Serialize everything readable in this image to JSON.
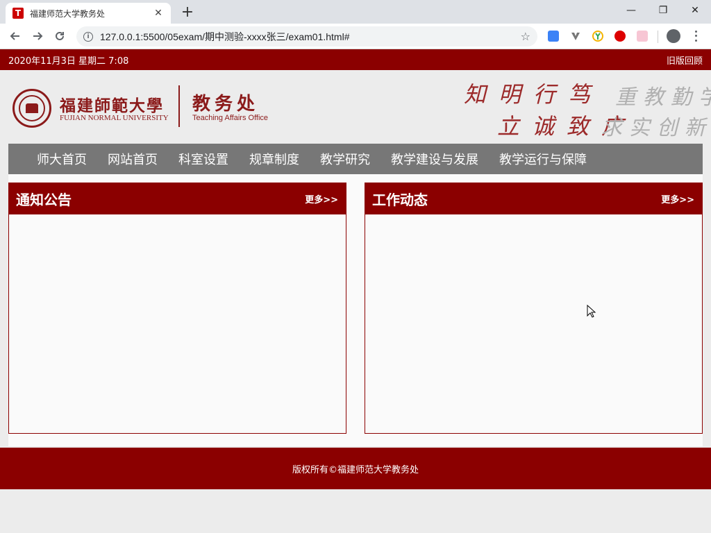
{
  "browser": {
    "tab_title": "福建师范大学教务处",
    "favicon_letter": "T",
    "close_glyph": "✕",
    "new_tab_glyph": "+",
    "url": "127.0.0.1:5500/05exam/期中测验-xxxx张三/exam01.html#",
    "window_controls": {
      "minimize": "—",
      "restore": "❐",
      "close": "✕"
    }
  },
  "topbar": {
    "date": "2020年11月3日 星期二 7:08",
    "old_version_link": "旧版回顾"
  },
  "header": {
    "university_cn": "福建師範大學",
    "university_en": "FUJIAN NORMAL UNIVERSITY",
    "office_cn": "教务处",
    "office_en": "Teaching Affairs Office",
    "motto_line1": "知明行笃",
    "motto_line2": "立诚致广",
    "motto_gray_line1": "重教勤学",
    "motto_gray_line2": "求实创新"
  },
  "nav": {
    "items": [
      "师大首页",
      "网站首页",
      "科室设置",
      "规章制度",
      "教学研究",
      "教学建设与发展",
      "教学运行与保障"
    ]
  },
  "notices": {
    "title": "通知公告",
    "more": "更多>>"
  },
  "news": {
    "title": "工作动态",
    "more": "更多>>"
  },
  "footer": {
    "copyright": "版权所有©福建师范大学教务处"
  },
  "colors": {
    "brand_red": "#8b0000",
    "nav_gray": "#777777"
  }
}
